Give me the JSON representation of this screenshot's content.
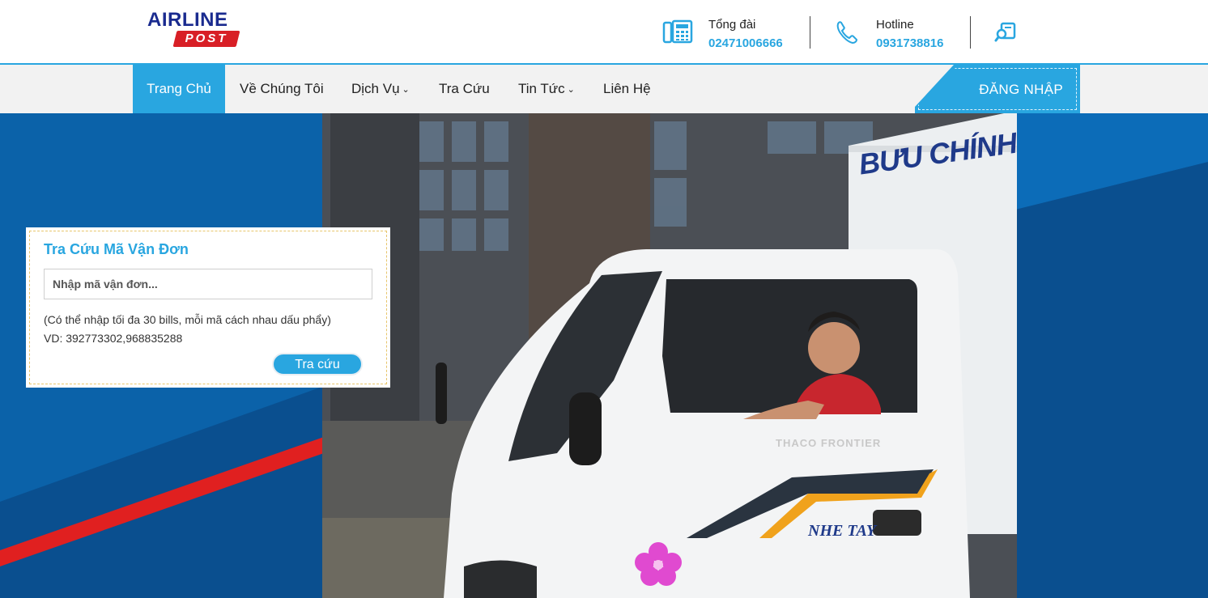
{
  "brand": {
    "logo_top": "AIRLINE",
    "logo_bottom": "POST",
    "colors": {
      "accent": "#29a6e0",
      "logo_navy": "#1a2b8f",
      "logo_red": "#d81f26",
      "hero_blue": "#0a62a8"
    }
  },
  "contacts": {
    "switchboard": {
      "label": "Tổng đài",
      "value": "02471006666",
      "icon": "office-phone-icon"
    },
    "hotline": {
      "label": "Hotline",
      "value": "0931738816",
      "icon": "phone-icon"
    },
    "search_icon": "search-document-icon"
  },
  "nav": {
    "items": [
      {
        "label": "Trang Chủ",
        "active": true,
        "dropdown": false
      },
      {
        "label": "Về Chúng Tôi",
        "active": false,
        "dropdown": false
      },
      {
        "label": "Dịch Vụ",
        "active": false,
        "dropdown": true
      },
      {
        "label": "Tra Cứu",
        "active": false,
        "dropdown": false
      },
      {
        "label": "Tin Tức",
        "active": false,
        "dropdown": true
      },
      {
        "label": "Liên Hệ",
        "active": false,
        "dropdown": false
      }
    ],
    "login_label": "ĐĂNG NHẬP"
  },
  "hero": {
    "truck_signage": "BƯU CHÍNH NỘI BÀI",
    "truck_model": "THACO FRONTIER",
    "truck_decal": "NHE TAY"
  },
  "tracking": {
    "title": "Tra Cứu Mã Vận Đơn",
    "placeholder": "Nhập mã vận đơn...",
    "hint": "(Có thể nhập tối đa 30 bills, mỗi mã cách nhau dấu phẩy)",
    "example": "VD: 392773302,968835288",
    "button_label": "Tra cứu"
  }
}
